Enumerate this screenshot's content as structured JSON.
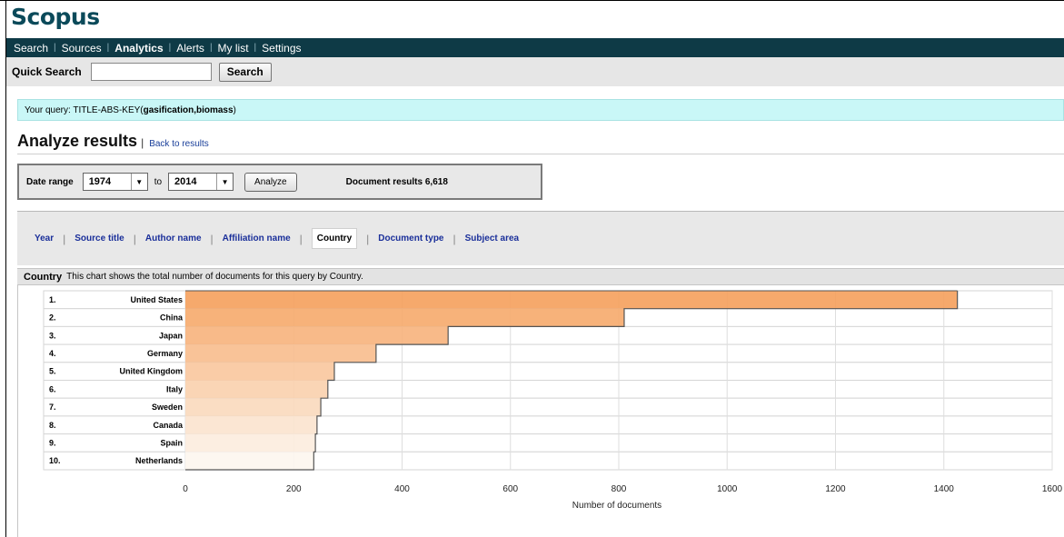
{
  "app": {
    "logo": "Scopus"
  },
  "nav": {
    "items": [
      {
        "label": "Search",
        "active": false
      },
      {
        "label": "Sources",
        "active": false
      },
      {
        "label": "Analytics",
        "active": true
      },
      {
        "label": "Alerts",
        "active": false
      },
      {
        "label": "My list",
        "active": false
      },
      {
        "label": "Settings",
        "active": false
      }
    ]
  },
  "quick_search": {
    "label": "Quick Search",
    "value": "",
    "button": "Search"
  },
  "query": {
    "prefix": "Your query:  TITLE-ABS-KEY(",
    "terms": "gasification,biomass",
    "suffix": ")"
  },
  "page": {
    "title": "Analyze results",
    "separator": "|",
    "back_link": "Back to results"
  },
  "date_range": {
    "label": "Date range",
    "from": "1974",
    "to_label": "to",
    "to": "2014",
    "button": "Analyze",
    "results": "Document results 6,618"
  },
  "tabs": [
    {
      "label": "Year",
      "selected": false
    },
    {
      "label": "Source title",
      "selected": false
    },
    {
      "label": "Author name",
      "selected": false
    },
    {
      "label": "Affiliation name",
      "selected": false
    },
    {
      "label": "Country",
      "selected": true
    },
    {
      "label": "Document type",
      "selected": false
    },
    {
      "label": "Subject area",
      "selected": false
    }
  ],
  "section": {
    "title": "Country",
    "description": "This chart shows the total number of documents for this query by Country."
  },
  "colors": {
    "nav_bg": "#0e3a46",
    "logo": "#0b4a5a",
    "bar_top": "#f5a05c",
    "bar_bottom": "#fdf6ee",
    "query_bg": "#c9f7f7"
  },
  "chart_data": {
    "type": "bar",
    "orientation": "horizontal",
    "categories": [
      "United States",
      "China",
      "Japan",
      "Germany",
      "United Kingdom",
      "Italy",
      "Sweden",
      "Canada",
      "Spain",
      "Netherlands"
    ],
    "ranks": [
      "1.",
      "2.",
      "3.",
      "4.",
      "5.",
      "6.",
      "7.",
      "8.",
      "9.",
      "10."
    ],
    "values": [
      1425,
      810,
      485,
      352,
      275,
      263,
      250,
      243,
      240,
      237
    ],
    "xlabel": "Number of documents",
    "xlim": [
      0,
      1600
    ],
    "xticks": [
      0,
      200,
      400,
      600,
      800,
      1000,
      1200,
      1400,
      1600
    ],
    "grid": true
  }
}
